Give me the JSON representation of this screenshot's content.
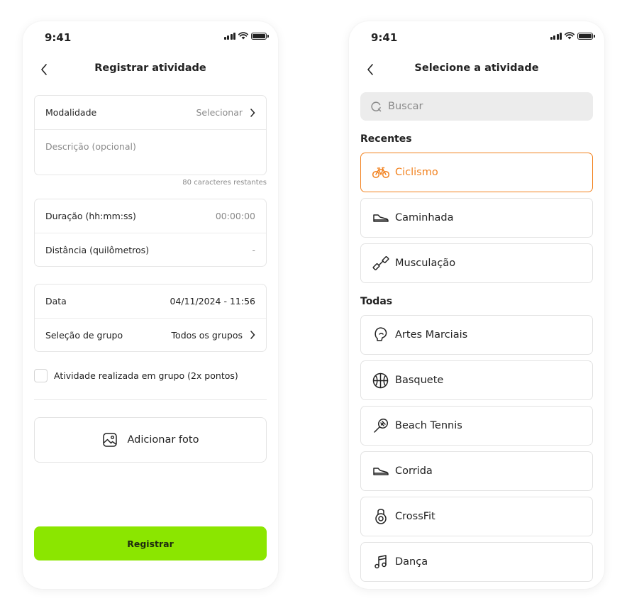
{
  "left_screen": {
    "status_time": "9:41",
    "title": "Registrar atividade",
    "modalidade": {
      "label": "Modalidade",
      "value": "Selecionar"
    },
    "description_placeholder": "Descrição (opcional)",
    "char_count": "80 caracteres restantes",
    "duration": {
      "label": "Duração (hh:mm:ss)",
      "value": "00:00:00"
    },
    "distance": {
      "label": "Distância (quilômetros)",
      "value": "-"
    },
    "date": {
      "label": "Data",
      "value": "04/11/2024 - 11:56"
    },
    "group": {
      "label": "Seleção de grupo",
      "value": "Todos os grupos"
    },
    "group_checkbox_label": "Atividade realizada em grupo (2x pontos)",
    "add_photo_label": "Adicionar foto",
    "submit_label": "Registrar"
  },
  "right_screen": {
    "status_time": "9:41",
    "title": "Selecione a atividade",
    "search_placeholder": "Buscar",
    "recent_title": "Recentes",
    "recent": [
      {
        "label": "Ciclismo",
        "icon": "bicycle-icon",
        "selected": true
      },
      {
        "label": "Caminhada",
        "icon": "shoe-icon"
      },
      {
        "label": "Musculação",
        "icon": "dumbbell-icon"
      }
    ],
    "all_title": "Todas",
    "all": [
      {
        "label": "Artes Marciais",
        "icon": "boxing-glove-icon"
      },
      {
        "label": "Basquete",
        "icon": "basketball-icon"
      },
      {
        "label": "Beach Tennis",
        "icon": "racket-icon"
      },
      {
        "label": "Corrida",
        "icon": "shoe-icon"
      },
      {
        "label": "CrossFit",
        "icon": "kettlebell-icon"
      },
      {
        "label": "Dança",
        "icon": "music-note-icon"
      }
    ]
  },
  "colors": {
    "accent_green": "#8be600",
    "selected_orange": "#f2821f",
    "muted_text": "#8a8a8a",
    "border": "#e6e6e6"
  }
}
